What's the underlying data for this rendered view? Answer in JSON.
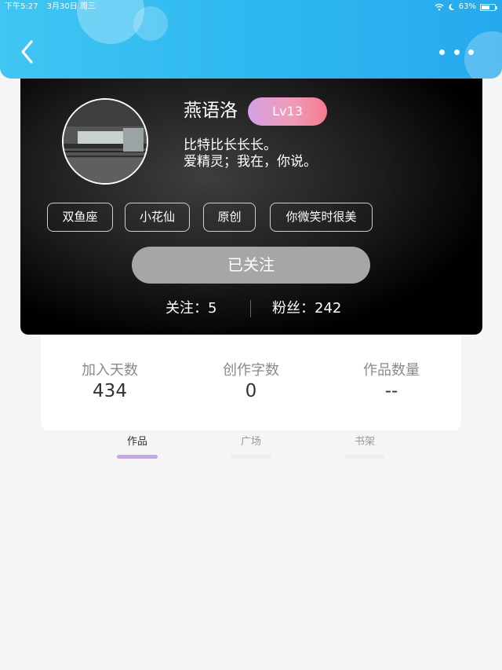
{
  "status_bar": {
    "time": "下午5:27",
    "date": "3月30日 周三",
    "battery": "63%",
    "battery_level": 0.63
  },
  "profile": {
    "nickname": "燕语洛",
    "level": "Lv13",
    "bio_line1": "比特比长长长。",
    "bio_line2": "爱精灵；我在，你说。",
    "tags": [
      "双鱼座",
      "小花仙",
      "原创",
      "你微笑时很美"
    ],
    "follow_button": "已关注",
    "following_label": "关注：5",
    "fans_label": "粉丝：242"
  },
  "stats": [
    {
      "label": "加入天数",
      "value": "434"
    },
    {
      "label": "创作字数",
      "value": "0"
    },
    {
      "label": "作品数量",
      "value": "--"
    }
  ],
  "tabs": [
    {
      "label": "作品",
      "active": true
    },
    {
      "label": "广场",
      "active": false
    },
    {
      "label": "书架",
      "active": false
    }
  ],
  "colors": {
    "header": "#2fb8f0",
    "level_badge": "#f19bb8",
    "active_tab_indicator": "#c9a6e8",
    "follow_button": "#a6a6a6"
  }
}
